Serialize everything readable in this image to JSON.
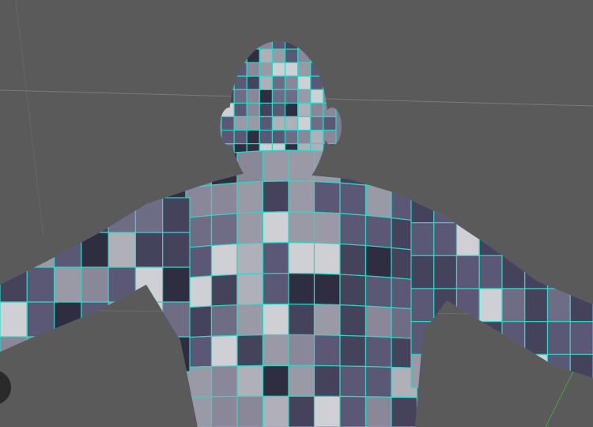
{
  "viewport": {
    "background_color": "#5a5a5a",
    "grid_line_color": "#7a7a7a",
    "axis_line_color": "#3fa83f",
    "wireframe_color": "#2fd6c8",
    "mesh_base_color": "#7d7b92",
    "mesh_shade_colors": [
      "#9a9aa6",
      "#8a8898",
      "#6f6d86",
      "#5a5874",
      "#45435c",
      "#b0b0b8",
      "#2f2e40",
      "#cfd0d4"
    ]
  }
}
